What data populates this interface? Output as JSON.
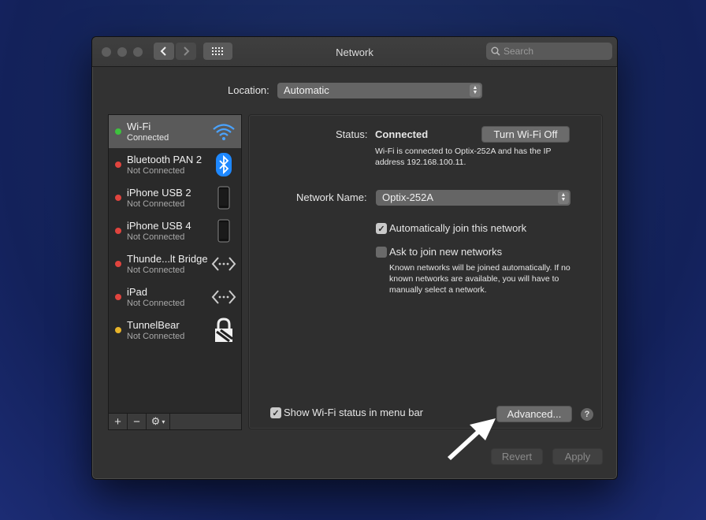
{
  "window": {
    "title": "Network",
    "search_placeholder": "Search"
  },
  "location": {
    "label": "Location:",
    "value": "Automatic"
  },
  "services": [
    {
      "name": "Wi-Fi",
      "status": "Connected",
      "dot": "#3ec23e",
      "icon": "wifi-icon"
    },
    {
      "name": "Bluetooth PAN 2",
      "status": "Not Connected",
      "dot": "#e0443e",
      "icon": "bluetooth-icon"
    },
    {
      "name": "iPhone USB 2",
      "status": "Not Connected",
      "dot": "#e0443e",
      "icon": "iphone-icon"
    },
    {
      "name": "iPhone USB 4",
      "status": "Not Connected",
      "dot": "#e0443e",
      "icon": "iphone-icon"
    },
    {
      "name": "Thunde...lt Bridge",
      "status": "Not Connected",
      "dot": "#e0443e",
      "icon": "ethernet-icon"
    },
    {
      "name": "iPad",
      "status": "Not Connected",
      "dot": "#e0443e",
      "icon": "ethernet-icon"
    },
    {
      "name": "TunnelBear",
      "status": "Not Connected",
      "dot": "#e8b42a",
      "icon": "lock-icon"
    }
  ],
  "sidebar_controls": {
    "add": "+",
    "remove": "−",
    "action": "⚙"
  },
  "detail": {
    "status_label": "Status:",
    "status_value": "Connected",
    "toggle_button": "Turn Wi-Fi Off",
    "status_description": "Wi-Fi is connected to Optix-252A and has the IP address 192.168.100.11.",
    "network_name_label": "Network Name:",
    "network_name_value": "Optix-252A",
    "auto_join_label": "Automatically join this network",
    "auto_join_checked": true,
    "ask_join_label": "Ask to join new networks",
    "ask_join_checked": false,
    "ask_join_description": "Known networks will be joined automatically. If no known networks are available, you will have to manually select a network.",
    "show_status_label": "Show Wi-Fi status in menu bar",
    "show_status_checked": true,
    "advanced_button": "Advanced...",
    "help": "?"
  },
  "footer": {
    "revert": "Revert",
    "apply": "Apply"
  }
}
